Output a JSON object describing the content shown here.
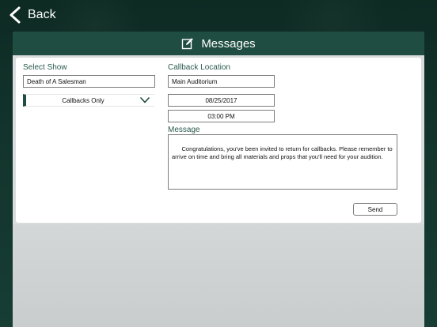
{
  "nav": {
    "back_label": "Back",
    "back_icon": "chevron-left-icon"
  },
  "header": {
    "title": "Messages",
    "icon": "compose-icon"
  },
  "form": {
    "select_show": {
      "label": "Select Show",
      "value": "Death of A Salesman"
    },
    "filter": {
      "selected": "Callbacks Only",
      "icon": "chevron-down-icon"
    },
    "callback_location": {
      "label": "Callback Location",
      "value": "Main Auditorium"
    },
    "date": {
      "value": "08/25/2017"
    },
    "time": {
      "value": "03:00 PM"
    },
    "message": {
      "label": "Message",
      "value": "Congratulations, you've been invited to return for callbacks. Please remember to arrive on time and bring all materials and props that you'll need for your audition."
    },
    "send_label": "Send"
  },
  "colors": {
    "accent": "#1f4d42",
    "label_text": "#2a5a4e",
    "panel_bg": "#d9dcdc"
  }
}
